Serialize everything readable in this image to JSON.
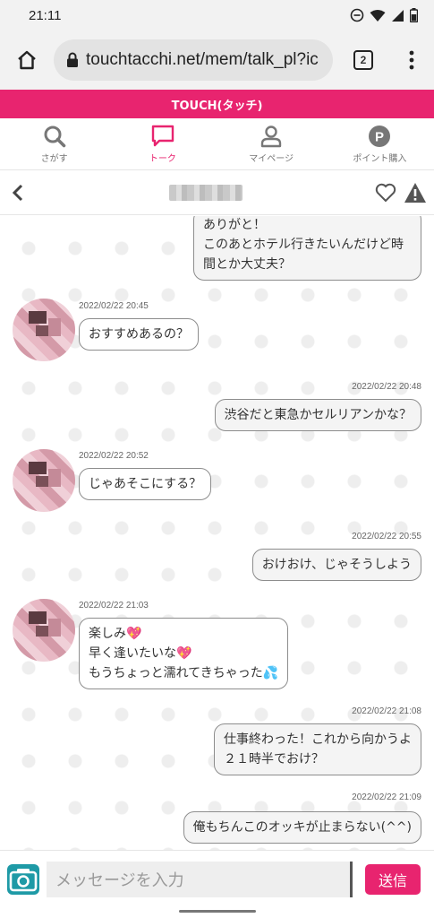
{
  "status_bar": {
    "time": "21:11"
  },
  "browser": {
    "url": "touchtacchi.net/mem/talk_pl?ic",
    "tab_count": "2"
  },
  "brand": {
    "title": "TOUCH(タッチ)",
    "accent_color": "#e8246f"
  },
  "nav": {
    "items": [
      {
        "label": "さがす",
        "icon": "search-icon"
      },
      {
        "label": "トーク",
        "icon": "chat-icon",
        "active": true
      },
      {
        "label": "マイページ",
        "icon": "person-icon"
      },
      {
        "label": "ポイント購入",
        "icon": "points-icon"
      }
    ]
  },
  "messages": [
    {
      "from": "me",
      "time": "",
      "text": "ありがと！\nこのあとホテル行きたいんだけど時\n間とか大丈夫？"
    },
    {
      "from": "partner",
      "time": "2022/02/22 20:45",
      "text": "おすすめあるの？"
    },
    {
      "from": "me",
      "time": "2022/02/22 20:48",
      "text": "渋谷だと東急かセルリアンかな？"
    },
    {
      "from": "partner",
      "time": "2022/02/22 20:52",
      "text": "じゃあそこにする？"
    },
    {
      "from": "me",
      "time": "2022/02/22 20:55",
      "text": "おけおけ、じゃそうしよう"
    },
    {
      "from": "partner",
      "time": "2022/02/22 21:03",
      "text": "楽しみ💖\n早く逢いたいな💖\nもうちょっと濡れてきちゃった💦"
    },
    {
      "from": "me",
      "time": "2022/02/22 21:08",
      "text": "仕事終わった！これから向かうよ\n２１時半でおけ？"
    },
    {
      "from": "me",
      "time": "2022/02/22 21:09",
      "text": "俺もちんこのオッキが止まらない(^^)"
    }
  ],
  "composer": {
    "placeholder": "メッセージを入力",
    "send_label": "送信"
  }
}
